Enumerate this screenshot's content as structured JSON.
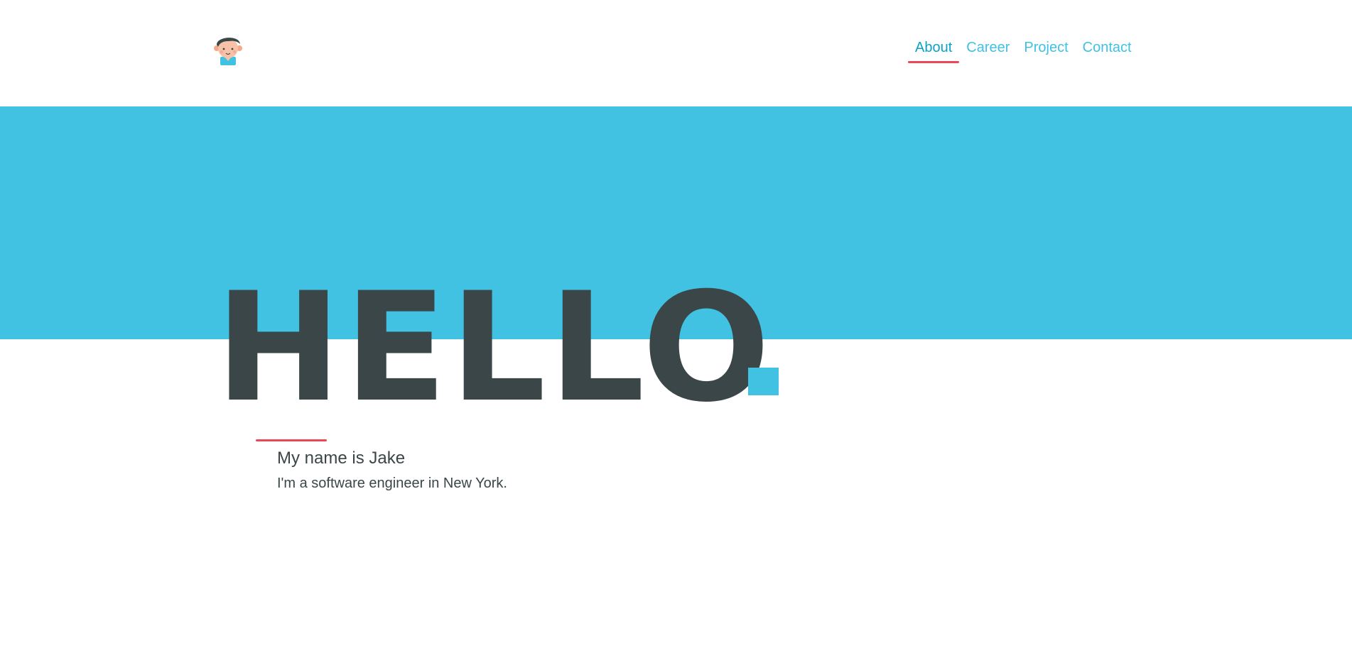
{
  "header": {
    "logo_icon": "avatar-icon",
    "nav": [
      {
        "label": "About",
        "active": true
      },
      {
        "label": "Career",
        "active": false
      },
      {
        "label": "Project",
        "active": false
      },
      {
        "label": "Contact",
        "active": false
      }
    ]
  },
  "hero": {
    "headline": "HELLO",
    "headline_dot_color": "#42c2e2",
    "band_color": "#42c2e2"
  },
  "intro": {
    "name": "My name is Jake",
    "description": "I'm a software engineer in New York."
  },
  "colors": {
    "accent": "#41c1e1",
    "active_nav": "#0aa3c2",
    "underline": "#ea4856",
    "text_dark": "#3a4647"
  }
}
